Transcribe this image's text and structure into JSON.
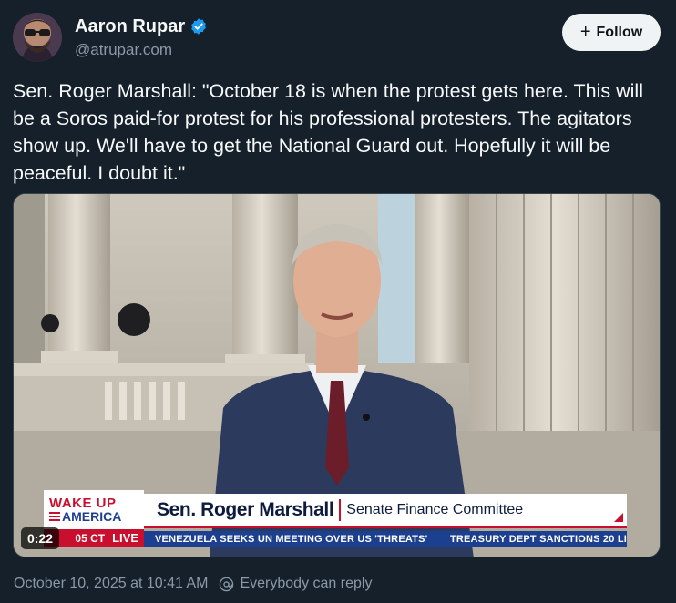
{
  "author": {
    "display_name": "Aaron Rupar",
    "handle": "@atrupar.com",
    "verified": true
  },
  "follow_button": {
    "label": "Follow",
    "icon": "plus-icon"
  },
  "tweet": {
    "text": "Sen. Roger Marshall: \"October 18 is when the protest gets here. This will be a Soros paid-for protest for his professional protesters. The agitators show up. We'll have to get the National Guard out. Hopefully it will be peaceful. I doubt it.\""
  },
  "video": {
    "duration": "0:22",
    "chyron": {
      "logo_top": "WAKE UP",
      "logo_bottom": "AMERICA",
      "name": "Sen. Roger Marshall",
      "role": "Senate Finance Committee",
      "time": "05 CT",
      "live": "LIVE",
      "ticker": [
        "VENEZUELA SEEKS UN MEETING OVER US 'THREATS'",
        "TREASURY DEPT SANCTIONS 20 LI"
      ]
    }
  },
  "footer": {
    "timestamp": "October 10, 2025 at 10:41 AM",
    "reply_setting": "Everybody can reply",
    "reply_icon": "at-sign-icon"
  },
  "colors": {
    "background": "#15202b",
    "verified": "#1d9bf0",
    "muted_text": "#8b98a5",
    "chyron_red": "#c8102e",
    "chyron_blue": "#1d3f8f"
  }
}
